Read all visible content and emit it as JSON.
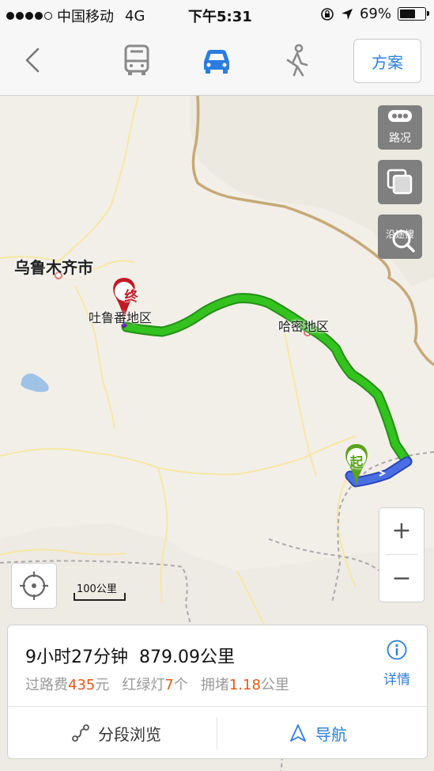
{
  "status_bar": {
    "carrier": "中国移动",
    "network": "4G",
    "time": "下午5:31",
    "battery": "69%",
    "battery_level": 0.69
  },
  "nav": {
    "modes": [
      "bus-icon",
      "car-icon",
      "walk-icon"
    ],
    "active_mode": "car-icon",
    "plan_label": "方案"
  },
  "map": {
    "labels": {
      "city_urumqi": "乌鲁木齐市",
      "turpan": "吐鲁番地区",
      "hami": "哈密地区"
    },
    "markers": {
      "end": "终",
      "start": "起"
    },
    "side_buttons": {
      "traffic": "路况",
      "along_search": "沿途搜"
    },
    "zoom_in": "+",
    "zoom_out": "−",
    "scale_label": "100公里",
    "colors": {
      "route_green": "#33c21e",
      "route_blue": "#4a6fe3",
      "boundary": "#c7a977",
      "end_marker": "#c21a26",
      "start_marker": "#5aa31c"
    }
  },
  "route": {
    "duration": "9小时27分钟",
    "distance": "879.09公里",
    "toll_prefix": "过路费",
    "toll_value": "435",
    "toll_unit": "元",
    "lights_prefix": "红绿灯",
    "lights_value": "7",
    "lights_unit": "个",
    "jam_prefix": "拥堵",
    "jam_value": "1.18",
    "jam_unit": "公里",
    "detail_label": "详情",
    "segment_label": "分段浏览",
    "navigate_label": "导航"
  }
}
